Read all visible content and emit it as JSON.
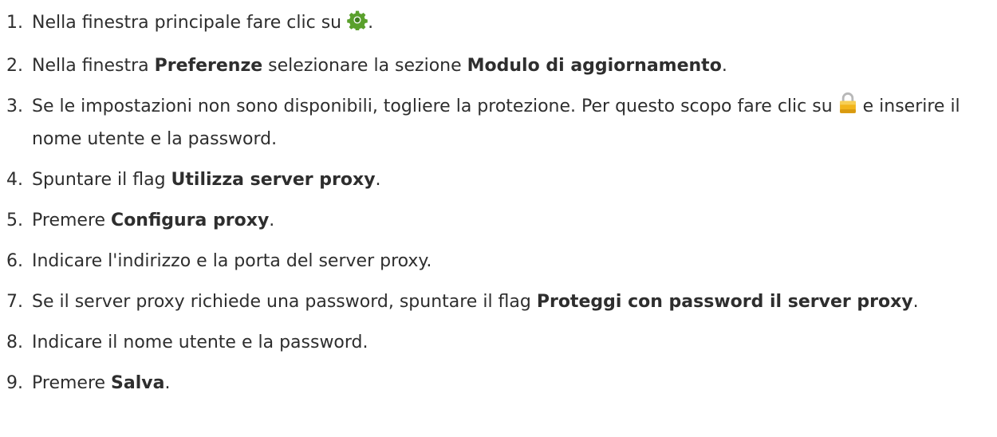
{
  "steps": [
    {
      "n": "1.",
      "parts": [
        "Nella finestra principale fare clic su ",
        "",
        "."
      ]
    },
    {
      "n": "2.",
      "parts": [
        "Nella finestra ",
        "Preferenze",
        " selezionare la sezione ",
        "Modulo di aggiornamento",
        "."
      ]
    },
    {
      "n": "3.",
      "parts": [
        "Se le impostazioni non sono disponibili, togliere la protezione. Per questo scopo fare clic su ",
        "",
        " e inserire il nome utente e la password."
      ]
    },
    {
      "n": "4.",
      "parts": [
        "Spuntare il flag ",
        "Utilizza server proxy",
        "."
      ]
    },
    {
      "n": "5.",
      "parts": [
        "Premere ",
        "Configura proxy",
        "."
      ]
    },
    {
      "n": "6.",
      "parts": [
        "Indicare l'indirizzo e la porta del server proxy."
      ]
    },
    {
      "n": "7.",
      "parts": [
        "Se il server proxy richiede una password, spuntare il flag ",
        "Proteggi con password il server proxy",
        "."
      ]
    },
    {
      "n": "8.",
      "parts": [
        "Indicare il nome utente e la password."
      ]
    },
    {
      "n": "9.",
      "parts": [
        "Premere ",
        "Salva",
        "."
      ]
    }
  ],
  "icons": {
    "settings": "gear-icon",
    "lock": "lock-icon"
  },
  "colors": {
    "text": "#2e2e2e",
    "gear_green": "#5aa02c",
    "lock_body": "#f2b51b",
    "lock_shackle": "#b8b8b8"
  }
}
